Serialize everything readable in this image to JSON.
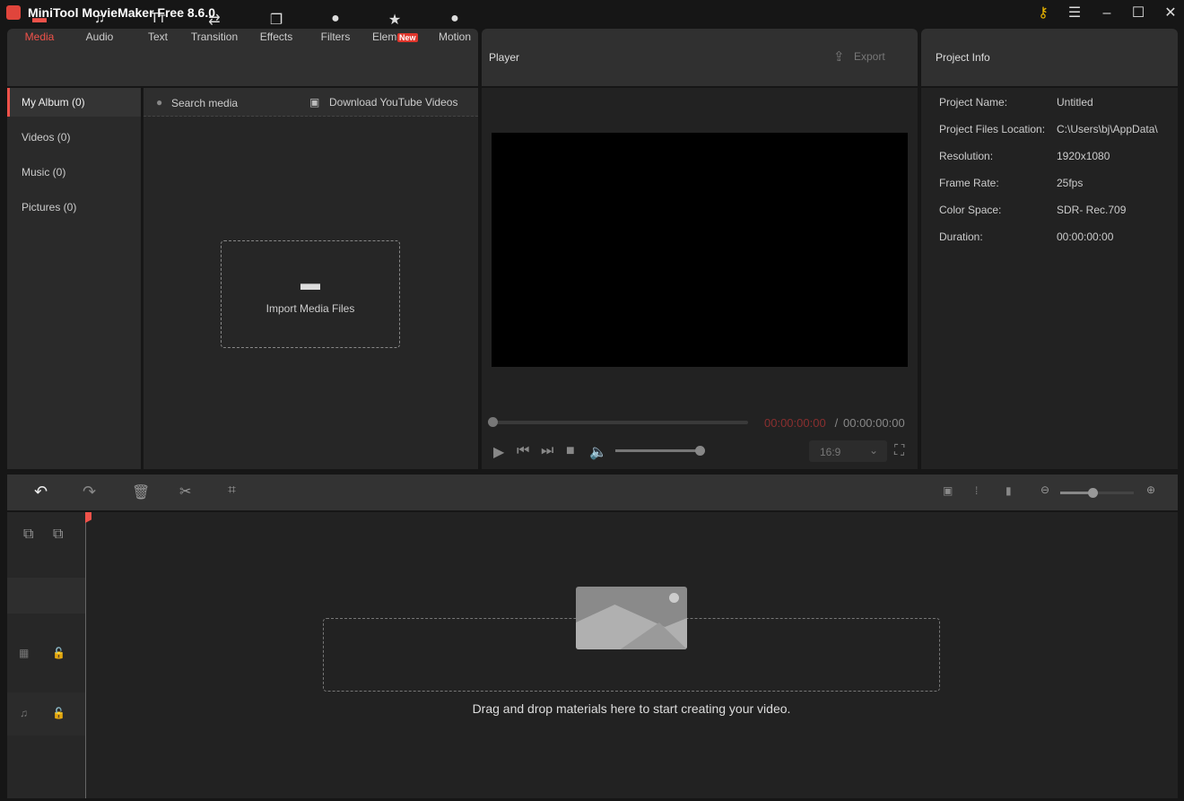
{
  "app": {
    "title": "MiniTool MovieMaker Free 8.6.0"
  },
  "window_controls": {
    "key": "key-icon",
    "menu": "menu-icon",
    "minimize": "minimize-icon",
    "maximize": "maximize-icon",
    "close": "close-icon"
  },
  "toolbar": {
    "tabs": [
      {
        "label": "Media",
        "icon": "folder-icon"
      },
      {
        "label": "Audio",
        "icon": "music-note-icon"
      },
      {
        "label": "Text",
        "icon": "text-icon"
      },
      {
        "label": "Transition",
        "icon": "swap-arrows-icon"
      },
      {
        "label": "Effects",
        "icon": "effects-icon"
      },
      {
        "label": "Filters",
        "icon": "filters-icon"
      },
      {
        "label": "Elements",
        "icon": "elements-icon"
      },
      {
        "label": "Motion",
        "icon": "motion-icon"
      }
    ],
    "new_badge": "New"
  },
  "sidebar": {
    "items": [
      {
        "label": "My Album (0)"
      },
      {
        "label": "Videos (0)"
      },
      {
        "label": "Music (0)"
      },
      {
        "label": "Pictures (0)"
      }
    ]
  },
  "media": {
    "search_placeholder": "Search media",
    "download_label": "Download YouTube Videos",
    "import_label": "Import Media Files"
  },
  "player": {
    "title": "Player",
    "export_label": "Export",
    "current_time": "00:00:00:00",
    "separator": " / ",
    "total_time": "00:00:00:00",
    "aspect_ratio": "16:9",
    "progress": 0,
    "volume": 1.0
  },
  "project_info": {
    "title": "Project Info",
    "rows": [
      {
        "label": "Project Name:",
        "value": "Untitled"
      },
      {
        "label": "Project Files Location:",
        "value": "C:\\Users\\bj\\AppData\\"
      },
      {
        "label": "Resolution:",
        "value": "1920x1080"
      },
      {
        "label": "Frame Rate:",
        "value": "25fps"
      },
      {
        "label": "Color Space:",
        "value": "SDR- Rec.709"
      },
      {
        "label": "Duration:",
        "value": "00:00:00:00"
      }
    ]
  },
  "timeline": {
    "drop_hint": "Drag and drop materials here to start creating your video.",
    "zoom_level": 0.45
  },
  "colors": {
    "accent": "#f0524a",
    "bg": "#222222"
  }
}
